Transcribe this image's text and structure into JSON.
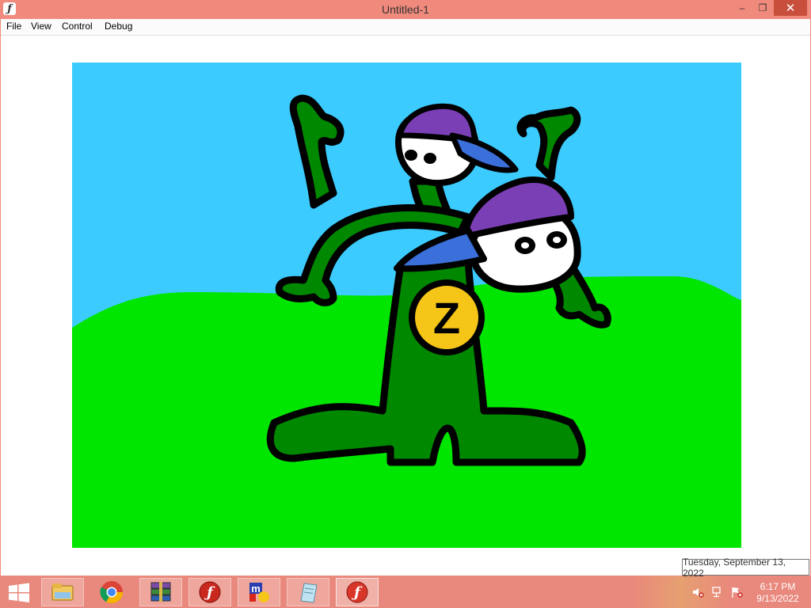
{
  "window": {
    "title": "Untitled-1",
    "controls": {
      "minimize": "–",
      "maximize": "❐",
      "close": "✕"
    }
  },
  "menu": {
    "items": [
      "File",
      "View",
      "Control",
      "Debug"
    ]
  },
  "stage": {
    "sky_color": "#3ccbff",
    "grass_color": "#00e600",
    "badge_letter": "Z"
  },
  "tooltip": {
    "text": "Tuesday, September 13, 2022"
  },
  "taskbar": {
    "apps": [
      {
        "name": "start-button-icon"
      },
      {
        "name": "file-explorer-icon"
      },
      {
        "name": "chrome-icon"
      },
      {
        "name": "winrar-icon"
      },
      {
        "name": "flash-player-icon"
      },
      {
        "name": "mplab-icon"
      },
      {
        "name": "notepad-icon"
      },
      {
        "name": "flash-projector-icon"
      }
    ],
    "clock": {
      "time": "6:17 PM",
      "date": "9/13/2022"
    }
  },
  "colors": {
    "title_bar": "#f08a7c",
    "close_button": "#c94f3d"
  }
}
